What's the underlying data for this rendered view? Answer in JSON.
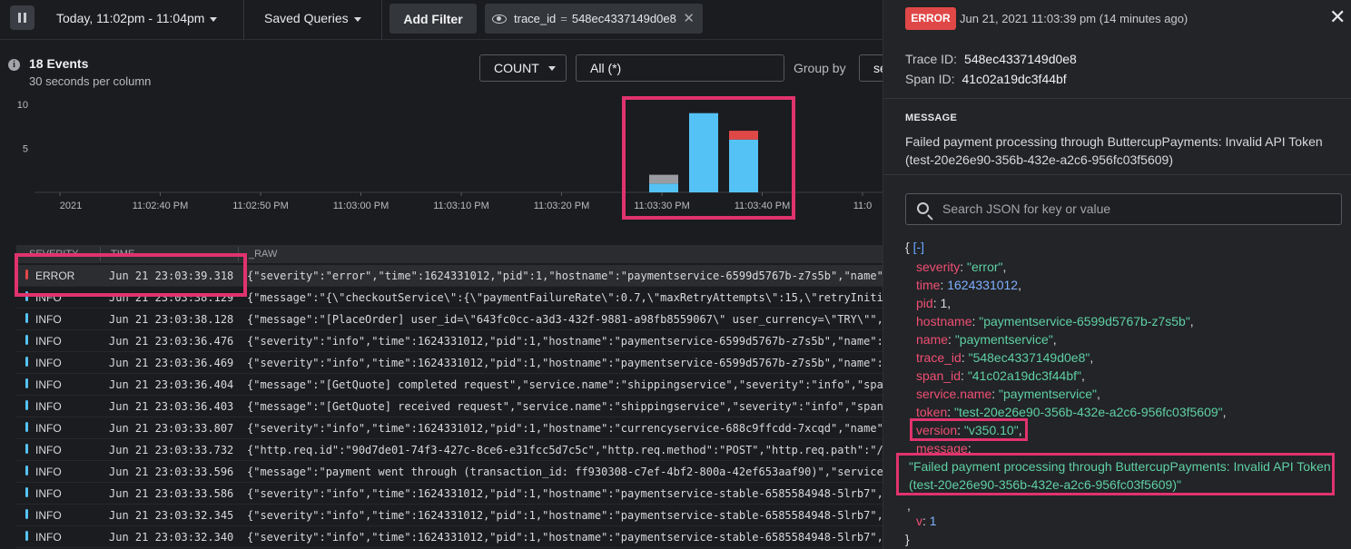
{
  "toolbar": {
    "time_range": "Today, 11:02pm - 11:04pm",
    "saved_queries": "Saved Queries",
    "add_filter": "Add Filter",
    "filter_chip": {
      "key": "trace_id",
      "op": "=",
      "value": "548ec4337149d0e8",
      "remove": "✕"
    }
  },
  "summary": {
    "title": "18 Events",
    "subtitle": "30 seconds per column",
    "aggregate": "COUNT",
    "field_value": "All (*)",
    "group_by_label": "Group by",
    "group_by_value": "se"
  },
  "colors": {
    "info": "#55c2f5",
    "error": "#e04848",
    "other": "#9a9ca1",
    "highlight": "#e0336d"
  },
  "chart_data": {
    "type": "bar",
    "stacked": true,
    "y_ticks": [
      "10",
      "5"
    ],
    "ylim": [
      0,
      10
    ],
    "x_tick_labels": [
      "2021",
      "11:02:40 PM",
      "11:02:50 PM",
      "11:03:00 PM",
      "11:03:10 PM",
      "11:03:20 PM",
      "11:03:30 PM",
      "11:03:40 PM",
      "11:0"
    ],
    "bars": [
      {
        "info": 1,
        "other": 1,
        "error": 0
      },
      {
        "info": 9,
        "other": 0,
        "error": 0
      },
      {
        "info": 6,
        "other": 0,
        "error": 1
      }
    ]
  },
  "table": {
    "headers": [
      "SEVERITY",
      "TIME",
      "_RAW"
    ],
    "rows": [
      {
        "level": "ERROR",
        "severity": "error",
        "time": "Jun 21 23:03:39.318",
        "raw": "{\"severity\":\"error\",\"time\":1624331012,\"pid\":1,\"hostname\":\"paymentservice-6599d5767b-z7s5b\",\"name\":\"p"
      },
      {
        "level": "INFO",
        "severity": "info",
        "time": "Jun 21 23:03:38.129",
        "raw": "{\"message\":\"{\\\"checkoutService\\\":{\\\"paymentFailureRate\\\":0.7,\\\"maxRetryAttempts\\\":15,\\\"retryInitialS"
      },
      {
        "level": "INFO",
        "severity": "info",
        "time": "Jun 21 23:03:38.128",
        "raw": "{\"message\":\"[PlaceOrder] user_id=\\\"643fc0cc-a3d3-432f-9881-a98fb8559067\\\" user_currency=\\\"TRY\\\"\",\"se"
      },
      {
        "level": "INFO",
        "severity": "info",
        "time": "Jun 21 23:03:36.476",
        "raw": "{\"severity\":\"info\",\"time\":1624331012,\"pid\":1,\"hostname\":\"paymentservice-6599d5767b-z7s5b\",\"name\":\"pa"
      },
      {
        "level": "INFO",
        "severity": "info",
        "time": "Jun 21 23:03:36.469",
        "raw": "{\"severity\":\"info\",\"time\":1624331012,\"pid\":1,\"hostname\":\"paymentservice-6599d5767b-z7s5b\",\"name\":\"pa"
      },
      {
        "level": "INFO",
        "severity": "info",
        "time": "Jun 21 23:03:36.404",
        "raw": "{\"message\":\"[GetQuote] completed request\",\"service.name\":\"shippingservice\",\"severity\":\"info\",\"span_id"
      },
      {
        "level": "INFO",
        "severity": "info",
        "time": "Jun 21 23:03:36.403",
        "raw": "{\"message\":\"[GetQuote] received request\",\"service.name\":\"shippingservice\",\"severity\":\"info\",\"span_id"
      },
      {
        "level": "INFO",
        "severity": "info",
        "time": "Jun 21 23:03:33.807",
        "raw": "{\"severity\":\"info\",\"time\":1624331012,\"pid\":1,\"hostname\":\"currencyservice-688c9ffcdd-7xcqd\",\"name\":\"c"
      },
      {
        "level": "INFO",
        "severity": "info",
        "time": "Jun 21 23:03:33.732",
        "raw": "{\"http.req.id\":\"90d7de01-74f3-427c-8ce6-e31fcc5d7c5c\",\"http.req.method\":\"POST\",\"http.req.path\":\"/car"
      },
      {
        "level": "INFO",
        "severity": "info",
        "time": "Jun 21 23:03:33.596",
        "raw": "{\"message\":\"payment went through (transaction_id: ff930308-c7ef-4bf2-800a-42ef653aaf90)\",\"service.nam"
      },
      {
        "level": "INFO",
        "severity": "info",
        "time": "Jun 21 23:03:33.586",
        "raw": "{\"severity\":\"info\",\"time\":1624331012,\"pid\":1,\"hostname\":\"paymentservice-stable-6585584948-5lrb7\",\"nam"
      },
      {
        "level": "INFO",
        "severity": "info",
        "time": "Jun 21 23:03:32.345",
        "raw": "{\"severity\":\"info\",\"time\":1624331012,\"pid\":1,\"hostname\":\"paymentservice-stable-6585584948-5lrb7\",\"nam"
      },
      {
        "level": "INFO",
        "severity": "info",
        "time": "Jun 21 23:03:32.340",
        "raw": "{\"severity\":\"info\",\"time\":1624331012,\"pid\":1,\"hostname\":\"paymentservice-stable-6585584948-5lrb7\",\"nam"
      }
    ]
  },
  "detail": {
    "badge": "ERROR",
    "timestamp": "Jun 21, 2021 11:03:39 pm (14 minutes ago)",
    "close": "✕",
    "trace_label": "Trace ID:",
    "trace_value": "548ec4337149d0e8",
    "span_label": "Span ID:",
    "span_value": "41c02a19dc3f44bf",
    "message_title": "MESSAGE",
    "message_body": "Failed payment processing through ButtercupPayments: Invalid API Token (test-20e26e90-356b-432e-a2c6-956fc03f5609)",
    "search_placeholder": "Search JSON for key or value",
    "json_open": "{",
    "json_collapse": "[-]",
    "json_close": "}",
    "json_trailing_comma": ",",
    "json_fields": [
      {
        "key": "severity",
        "value": "\"error\"",
        "kind": "string"
      },
      {
        "key": "time",
        "value": "1624331012",
        "kind": "number"
      },
      {
        "key": "pid",
        "value": "1",
        "kind": "plain"
      },
      {
        "key": "hostname",
        "value": "\"paymentservice-6599d5767b-z7s5b\"",
        "kind": "string"
      },
      {
        "key": "name",
        "value": "\"paymentservice\"",
        "kind": "string"
      },
      {
        "key": "trace_id",
        "value": "\"548ec4337149d0e8\"",
        "kind": "string"
      },
      {
        "key": "span_id",
        "value": "\"41c02a19dc3f44bf\"",
        "kind": "string"
      },
      {
        "key": "service.name",
        "value": "\"paymentservice\"",
        "kind": "string"
      },
      {
        "key": "token",
        "value": "\"test-20e26e90-356b-432e-a2c6-956fc03f5609\"",
        "kind": "string"
      },
      {
        "key": "version",
        "value": "\"v350.10\"",
        "kind": "string"
      },
      {
        "key": "message",
        "value": "",
        "kind": "string"
      }
    ],
    "message_value_line1": "\"Failed payment processing through ButtercupPayments: Invalid API Token",
    "message_value_line2": "(test-20e26e90-356b-432e-a2c6-956fc03f5609)\"",
    "v_key": "v",
    "v_value": "1"
  }
}
